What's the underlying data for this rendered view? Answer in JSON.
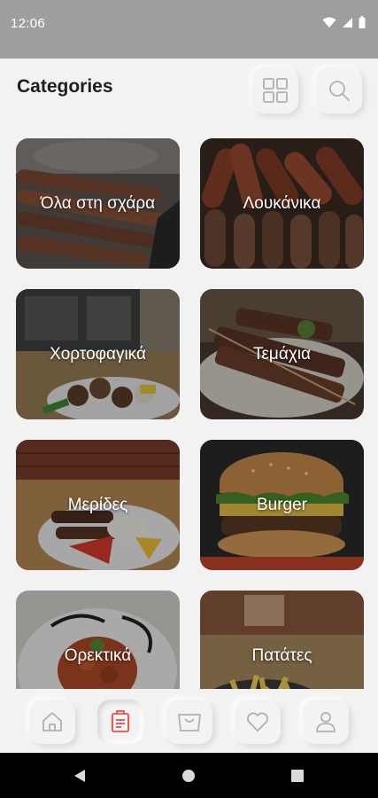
{
  "status_bar": {
    "time": "12:06"
  },
  "header": {
    "title": "Categories"
  },
  "categories": [
    {
      "label": "Όλα στη σχάρα"
    },
    {
      "label": "Λουκάνικα"
    },
    {
      "label": "Χορτοφαγικά"
    },
    {
      "label": "Τεμάχια"
    },
    {
      "label": "Μερίδες"
    },
    {
      "label": "Burger"
    },
    {
      "label": "Ορεκτικά"
    },
    {
      "label": "Πατάτες"
    }
  ],
  "colors": {
    "accent": "#e53935",
    "icon_gray": "#b0b0b0",
    "background": "#f2f2f2"
  }
}
